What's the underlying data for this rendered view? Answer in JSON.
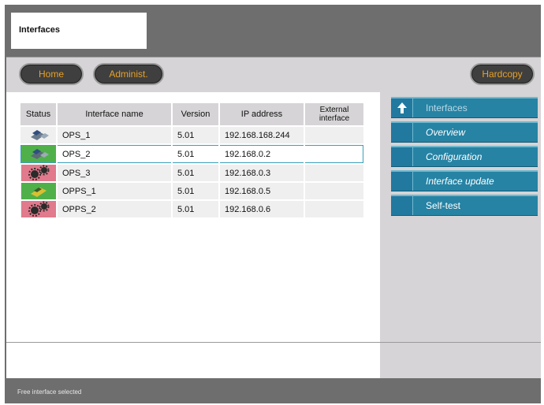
{
  "app": {
    "title": "Interfaces"
  },
  "nav": {
    "home": "Home",
    "admin": "Administ.",
    "hardcopy": "Hardcopy"
  },
  "table": {
    "headers": {
      "status": "Status",
      "name": "Interface name",
      "version": "Version",
      "ip": "IP address",
      "ext": "External interface"
    },
    "rows": [
      {
        "icon": "ops-connected-icon",
        "name": "OPS_1",
        "version": "5.01",
        "ip": "192.168.168.244",
        "ext": ""
      },
      {
        "icon": "ops-free-icon",
        "name": "OPS_2",
        "version": "5.01",
        "ip": "192.168.0.2",
        "ext": "",
        "selected": true
      },
      {
        "icon": "ops-error-gear-icon",
        "name": "OPS_3",
        "version": "5.01",
        "ip": "192.168.0.3",
        "ext": ""
      },
      {
        "icon": "opps-free-icon",
        "name": "OPPS_1",
        "version": "5.01",
        "ip": "192.168.0.5",
        "ext": ""
      },
      {
        "icon": "opps-error-gear-icon",
        "name": "OPPS_2",
        "version": "5.01",
        "ip": "192.168.0.6",
        "ext": ""
      }
    ]
  },
  "menu": {
    "items": [
      {
        "label": "Interfaces"
      },
      {
        "label": "Overview"
      },
      {
        "label": "Configuration"
      },
      {
        "label": "Interface update"
      },
      {
        "label": "Self-test"
      }
    ]
  },
  "status": {
    "text": "Free interface selected"
  },
  "colors": {
    "accent": "#2683a4",
    "button_text": "#e8a126",
    "status_ok": "#4fb04a",
    "status_error": "#e07a8c"
  }
}
